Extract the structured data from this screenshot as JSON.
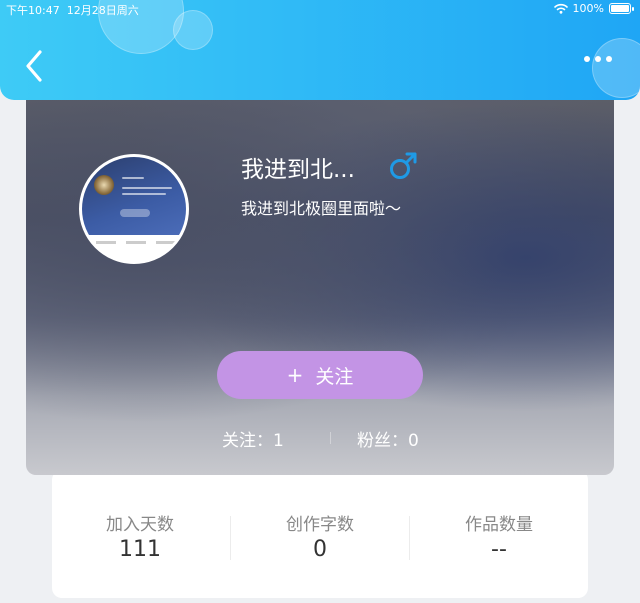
{
  "status_bar": {
    "time": "下午10:47",
    "date": "12月28日周六",
    "battery": "100%"
  },
  "header": {
    "back_icon": "chevron-left-icon",
    "more_icon": "more-dots-icon"
  },
  "profile": {
    "nickname": "我进到北...",
    "gender_symbol": "♂",
    "bio": "我进到北极圈里面啦～",
    "follow_plus": "+",
    "follow_label": "关注",
    "following_label": "关注：1",
    "fans_label": "粉丝：0"
  },
  "stats": [
    {
      "label": "加入天数",
      "value": "111"
    },
    {
      "label": "创作字数",
      "value": "0"
    },
    {
      "label": "作品数量",
      "value": "--"
    }
  ],
  "colors": {
    "header_start": "#3ecbf6",
    "header_end": "#1fa6f5",
    "follow_button": "#c394e5",
    "gender_icon": "#1f9ae6"
  }
}
